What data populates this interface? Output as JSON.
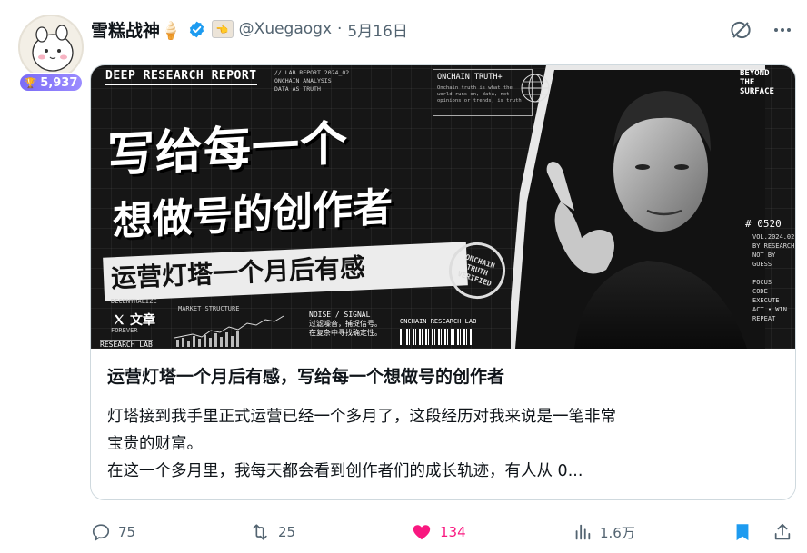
{
  "author": {
    "name": "雪糕战神🍦",
    "handle": "@Xuegaogx",
    "separator": "·",
    "date": "5月16日",
    "badge_count": "5,937",
    "avatar_icon": "bunny-avatar-icon",
    "verified_icon": "verified-badge-icon",
    "affiliation_icon": "pointing-hand-icon",
    "affiliation_glyph": "👈"
  },
  "top_actions": {
    "grok_icon": "grok-icon",
    "more_icon": "more-dots-icon"
  },
  "article": {
    "image": {
      "report_label": "DEEP RESEARCH REPORT",
      "lab_meta": [
        "// LAB REPORT 2024_02",
        "ONCHAIN ANALYSIS",
        "DATA AS TRUTH"
      ],
      "onchain_box_title": "ONCHAIN TRUTH+",
      "onchain_box_sub": "Onchain truth is what the world runs on, data, not opinions or trends, is truth.",
      "beyond": [
        "BEYOND",
        "THE",
        "SURFACE"
      ],
      "headline_line1": "写给每一个",
      "headline_line2": "想做号的创作者",
      "headline_band": "运营灯塔一个月后有感",
      "stamp": "ONCHAIN TRUTH VERIFIED",
      "side_big": "# 0520",
      "side_data": [
        "VOL.2024.02",
        "BY RESEARCH",
        "NOT BY GUESS",
        "",
        "FOCUS",
        "CODE",
        "EXECUTE",
        "ACT • WIN",
        "REPEAT"
      ],
      "x_tag_label": "文章",
      "x_logo_icon": "x-logo-icon",
      "bottom_left": [
        "DECENTRALIZE",
        "FOREVER"
      ],
      "market_structure": "MARKET STRUCTURE",
      "noise_signal": [
        "NOISE / SIGNAL",
        "过滤噪音，捕捉信号。",
        "在复杂中寻找确定性。"
      ],
      "onchain_lab": "ONCHAIN RESEARCH LAB",
      "research_lab": "RESEARCH LAB"
    },
    "title": "运营灯塔一个月后有感，写给每一个想做号的创作者",
    "description_line1": "灯塔接到我手里正式运营已经一个多月了，这段经历对我来说是一笔非常",
    "description_line2": "宝贵的财富。",
    "description_line3": "在这一个多月里，我每天都会看到创作者们的成长轨迹，有人从 0..."
  },
  "actions": {
    "reply_count": "75",
    "retweet_count": "25",
    "like_count": "134",
    "views_count": "1.6万",
    "like_color": "#f91880",
    "bookmark_color": "#1d9bf0"
  }
}
